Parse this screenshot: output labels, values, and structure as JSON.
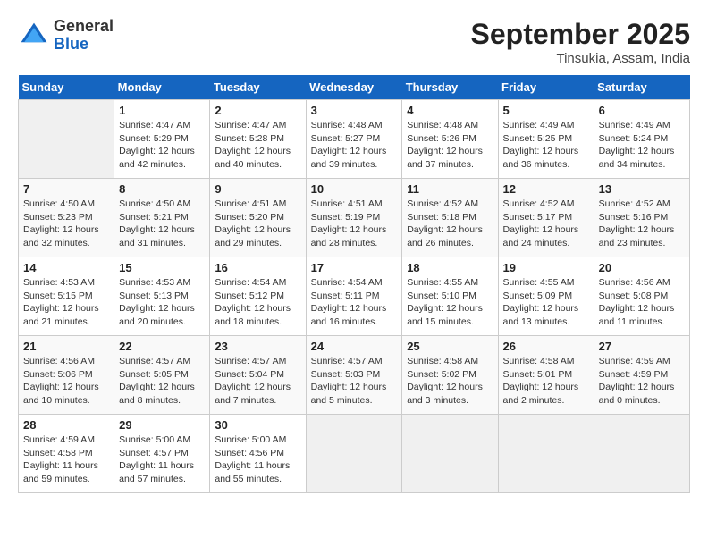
{
  "header": {
    "logo_general": "General",
    "logo_blue": "Blue",
    "month": "September 2025",
    "location": "Tinsukia, Assam, India"
  },
  "days_of_week": [
    "Sunday",
    "Monday",
    "Tuesday",
    "Wednesday",
    "Thursday",
    "Friday",
    "Saturday"
  ],
  "weeks": [
    [
      {
        "day": "",
        "info": ""
      },
      {
        "day": "1",
        "info": "Sunrise: 4:47 AM\nSunset: 5:29 PM\nDaylight: 12 hours and 42 minutes."
      },
      {
        "day": "2",
        "info": "Sunrise: 4:47 AM\nSunset: 5:28 PM\nDaylight: 12 hours and 40 minutes."
      },
      {
        "day": "3",
        "info": "Sunrise: 4:48 AM\nSunset: 5:27 PM\nDaylight: 12 hours and 39 minutes."
      },
      {
        "day": "4",
        "info": "Sunrise: 4:48 AM\nSunset: 5:26 PM\nDaylight: 12 hours and 37 minutes."
      },
      {
        "day": "5",
        "info": "Sunrise: 4:49 AM\nSunset: 5:25 PM\nDaylight: 12 hours and 36 minutes."
      },
      {
        "day": "6",
        "info": "Sunrise: 4:49 AM\nSunset: 5:24 PM\nDaylight: 12 hours and 34 minutes."
      }
    ],
    [
      {
        "day": "7",
        "info": "Sunrise: 4:50 AM\nSunset: 5:23 PM\nDaylight: 12 hours and 32 minutes."
      },
      {
        "day": "8",
        "info": "Sunrise: 4:50 AM\nSunset: 5:21 PM\nDaylight: 12 hours and 31 minutes."
      },
      {
        "day": "9",
        "info": "Sunrise: 4:51 AM\nSunset: 5:20 PM\nDaylight: 12 hours and 29 minutes."
      },
      {
        "day": "10",
        "info": "Sunrise: 4:51 AM\nSunset: 5:19 PM\nDaylight: 12 hours and 28 minutes."
      },
      {
        "day": "11",
        "info": "Sunrise: 4:52 AM\nSunset: 5:18 PM\nDaylight: 12 hours and 26 minutes."
      },
      {
        "day": "12",
        "info": "Sunrise: 4:52 AM\nSunset: 5:17 PM\nDaylight: 12 hours and 24 minutes."
      },
      {
        "day": "13",
        "info": "Sunrise: 4:52 AM\nSunset: 5:16 PM\nDaylight: 12 hours and 23 minutes."
      }
    ],
    [
      {
        "day": "14",
        "info": "Sunrise: 4:53 AM\nSunset: 5:15 PM\nDaylight: 12 hours and 21 minutes."
      },
      {
        "day": "15",
        "info": "Sunrise: 4:53 AM\nSunset: 5:13 PM\nDaylight: 12 hours and 20 minutes."
      },
      {
        "day": "16",
        "info": "Sunrise: 4:54 AM\nSunset: 5:12 PM\nDaylight: 12 hours and 18 minutes."
      },
      {
        "day": "17",
        "info": "Sunrise: 4:54 AM\nSunset: 5:11 PM\nDaylight: 12 hours and 16 minutes."
      },
      {
        "day": "18",
        "info": "Sunrise: 4:55 AM\nSunset: 5:10 PM\nDaylight: 12 hours and 15 minutes."
      },
      {
        "day": "19",
        "info": "Sunrise: 4:55 AM\nSunset: 5:09 PM\nDaylight: 12 hours and 13 minutes."
      },
      {
        "day": "20",
        "info": "Sunrise: 4:56 AM\nSunset: 5:08 PM\nDaylight: 12 hours and 11 minutes."
      }
    ],
    [
      {
        "day": "21",
        "info": "Sunrise: 4:56 AM\nSunset: 5:06 PM\nDaylight: 12 hours and 10 minutes."
      },
      {
        "day": "22",
        "info": "Sunrise: 4:57 AM\nSunset: 5:05 PM\nDaylight: 12 hours and 8 minutes."
      },
      {
        "day": "23",
        "info": "Sunrise: 4:57 AM\nSunset: 5:04 PM\nDaylight: 12 hours and 7 minutes."
      },
      {
        "day": "24",
        "info": "Sunrise: 4:57 AM\nSunset: 5:03 PM\nDaylight: 12 hours and 5 minutes."
      },
      {
        "day": "25",
        "info": "Sunrise: 4:58 AM\nSunset: 5:02 PM\nDaylight: 12 hours and 3 minutes."
      },
      {
        "day": "26",
        "info": "Sunrise: 4:58 AM\nSunset: 5:01 PM\nDaylight: 12 hours and 2 minutes."
      },
      {
        "day": "27",
        "info": "Sunrise: 4:59 AM\nSunset: 4:59 PM\nDaylight: 12 hours and 0 minutes."
      }
    ],
    [
      {
        "day": "28",
        "info": "Sunrise: 4:59 AM\nSunset: 4:58 PM\nDaylight: 11 hours and 59 minutes."
      },
      {
        "day": "29",
        "info": "Sunrise: 5:00 AM\nSunset: 4:57 PM\nDaylight: 11 hours and 57 minutes."
      },
      {
        "day": "30",
        "info": "Sunrise: 5:00 AM\nSunset: 4:56 PM\nDaylight: 11 hours and 55 minutes."
      },
      {
        "day": "",
        "info": ""
      },
      {
        "day": "",
        "info": ""
      },
      {
        "day": "",
        "info": ""
      },
      {
        "day": "",
        "info": ""
      }
    ]
  ]
}
